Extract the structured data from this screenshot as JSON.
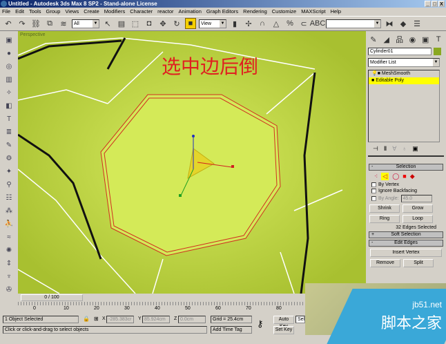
{
  "window": {
    "title": "Untitled - Autodesk 3ds Max 8 SP2  - Stand-alone License",
    "min": "_",
    "max": "□",
    "close": "X"
  },
  "menu": [
    "File",
    "Edit",
    "Tools",
    "Group",
    "Views",
    "Create",
    "Modifiers",
    "Character",
    "reactor",
    "Animation",
    "Graph Editors",
    "Rendering",
    "Customize",
    "MAXScript",
    "Help"
  ],
  "toolbar": {
    "selection_filter": "All",
    "ref_coord": "View",
    "named_sel": ""
  },
  "viewport": {
    "label": "Perspective",
    "overlay_text": "选中边后倒"
  },
  "command_panel": {
    "object_name": "Cylinder01",
    "object_color": "#8aa820",
    "modifier_list": "Modifier List",
    "stack": [
      {
        "label": "MeshSmooth"
      },
      {
        "label": "Editable Poly",
        "selected": true
      }
    ],
    "selection": {
      "title": "Selection",
      "by_vertex": "By Vertex",
      "ignore_backfacing": "Ignore Backfacing",
      "by_angle": "By Angle:",
      "angle_value": "45.0",
      "shrink": "Shrink",
      "grow": "Grow",
      "ring": "Ring",
      "loop": "Loop",
      "status": "32 Edges Selected"
    },
    "soft_selection": "Soft Selection",
    "edit_edges": "Edit Edges",
    "insert_vertex": "Insert Vertex",
    "remove": "Remove",
    "split": "Split"
  },
  "timeline": {
    "frame": "0 / 100",
    "ticks": [
      "0",
      "10",
      "20",
      "30",
      "40",
      "50",
      "60",
      "70",
      "80"
    ]
  },
  "status": {
    "selected": "1 Object Selected",
    "prompt": "Click or click-and-drag to select objects",
    "x_label": "X",
    "x": "-285.383cr",
    "y_label": "Y",
    "y": "85.924cm",
    "z_label": "Z",
    "z": "0.0cm",
    "grid": "Grid = 25.4cm",
    "add_time_tag": "Add Time Tag",
    "auto_key": "Auto Key",
    "set_key": "Set Key",
    "key_mode": "Sele"
  },
  "watermark": {
    "site": "jb51.net",
    "name": "脚本之家"
  }
}
